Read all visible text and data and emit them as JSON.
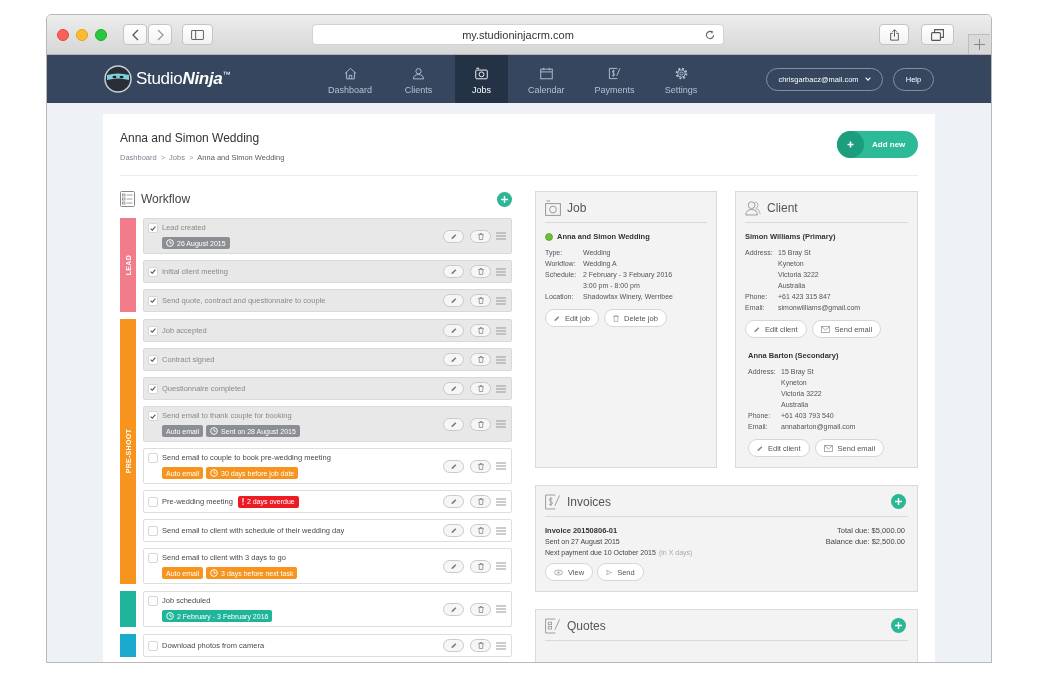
{
  "browser": {
    "url": "my.studioninjacrm.com"
  },
  "nav": {
    "logo": "Studio**Ninja**$^{™}$",
    "items": [
      {
        "label": "Dashboard",
        "selected": false
      },
      {
        "label": "Clients",
        "selected": false
      },
      {
        "label": "Jobs",
        "selected": true
      },
      {
        "label": "Calendar",
        "selected": false
      },
      {
        "label": "Payments",
        "selected": false
      },
      {
        "label": "Settings",
        "selected": false
      }
    ],
    "account": "chrisgarbacz@mail.com",
    "help": "Help"
  },
  "page": {
    "title": "Anna and Simon Wedding",
    "breadcrumb": [
      {
        "kind": "link",
        "text": "Dashboard"
      },
      {
        "kind": "separator",
        "text": ">"
      },
      {
        "kind": "link",
        "text": "Jobs"
      },
      {
        "kind": "separator",
        "text": ">"
      },
      {
        "kind": "current",
        "text": "Anna and Simon Wedding"
      }
    ],
    "add_button": "Add new"
  },
  "workflow": {
    "title": "Workflow",
    "stages": [
      {
        "label": "LEAD",
        "color": "#f07c8c",
        "tasks": [
          {
            "label": "Lead created",
            "checked": true,
            "tags": [
              {
                "kind": "clock",
                "text": "26 August 2015",
                "color": "#8b8e93"
              }
            ]
          },
          {
            "label": "Initial client meeting",
            "checked": true
          },
          {
            "label": "Send quote, contract and questionnaire to couple",
            "checked": true
          }
        ]
      },
      {
        "label": "PRE-SHOOT",
        "color": "#f7941e",
        "tasks": [
          {
            "label": "Job accepted",
            "checked": true
          },
          {
            "label": "Contract signed",
            "checked": true
          },
          {
            "label": "Questionnaire completed",
            "checked": true
          },
          {
            "label": "Send email to thank couple for booking",
            "checked": true,
            "tags": [
              {
                "kind": "plain",
                "text": "Auto email",
                "color": "#8b8e93"
              },
              {
                "kind": "clock",
                "text": "Sent on 28 August 2015",
                "color": "#8b8e93"
              }
            ]
          },
          {
            "label": "Send email to couple to book pre-wedding meeting",
            "checked": false,
            "tags": [
              {
                "kind": "plain",
                "text": "Auto email",
                "color": "#f7941e"
              },
              {
                "kind": "clock",
                "text": "30 days before job date",
                "color": "#f7941e"
              }
            ]
          },
          {
            "label": "Pre-wedding meeting",
            "checked": false,
            "tags": [
              {
                "kind": "alert",
                "text": "2 days overdue",
                "color": "#ed1c24"
              }
            ]
          },
          {
            "label": "Send email to client with schedule of their wedding day",
            "checked": false
          },
          {
            "label": "Send email to client with 3 days to go",
            "checked": false,
            "tags": [
              {
                "kind": "plain",
                "text": "Auto email",
                "color": "#f7941e"
              },
              {
                "kind": "clock",
                "text": "3 days before next task",
                "color": "#f7941e"
              }
            ]
          }
        ]
      },
      {
        "color": "#20b59a",
        "tasks": [
          {
            "label": "Job scheduled",
            "checked": false,
            "tags": [
              {
                "kind": "clock",
                "text": "2 February - 3 February 2016",
                "color": "#20b59a"
              }
            ]
          }
        ]
      },
      {
        "color": "#1ca9cf",
        "tasks": [
          {
            "label": "Download photos from camera",
            "checked": false
          }
        ]
      }
    ]
  },
  "job": {
    "title": "Job",
    "name": "Anna and Simon Wedding",
    "details": [
      {
        "label": "Type:",
        "lines": [
          "Wedding"
        ]
      },
      {
        "label": "Workflow:",
        "lines": [
          "Wedding A"
        ]
      },
      {
        "label": "Schedule:",
        "lines": [
          "2 February - 3 Febuary 2016",
          "3:00 pm - 8:00 pm"
        ]
      },
      {
        "label": "Location:",
        "lines": [
          "Shadowfax Winery, Werribee"
        ]
      }
    ],
    "buttons": [
      {
        "kind": "edit",
        "label": "Edit job"
      },
      {
        "kind": "delete",
        "label": "Delete job"
      }
    ]
  },
  "client": {
    "title": "Client",
    "contacts": [
      {
        "name": "Simon Williams (Primary)",
        "details": [
          {
            "label": "Address:",
            "lines": [
              "15 Bray St",
              "Kyneton",
              "Victoria 3222",
              "Australia"
            ]
          },
          {
            "label": "Phone:",
            "lines": [
              "+61 423 315 847"
            ]
          },
          {
            "label": "Email:",
            "lines": [
              "simonwilliams@gmail.com"
            ]
          }
        ],
        "buttons": [
          {
            "kind": "edit",
            "label": "Edit client"
          },
          {
            "kind": "email",
            "label": "Send email"
          }
        ]
      },
      {
        "name": "Anna Barton (Secondary)",
        "details": [
          {
            "label": "Address:",
            "lines": [
              "15 Bray St",
              "Kyneton",
              "Victoria 3222",
              "Australia"
            ]
          },
          {
            "label": "Phone:",
            "lines": [
              "+61 403 793 540"
            ]
          },
          {
            "label": "Email:",
            "lines": [
              "annabarton@gmail.com"
            ]
          }
        ],
        "buttons": [
          {
            "kind": "edit",
            "label": "Edit client"
          },
          {
            "kind": "email",
            "label": "Send email"
          }
        ]
      }
    ]
  },
  "invoices": {
    "title": "Invoices",
    "items": [
      {
        "number": "Invoice 20150806-01",
        "sent": "Sent on 27 August 2015",
        "next_payment": "Next payment due 10 October 2015",
        "next_payment_note": "(in X days)",
        "total": "Total due: $5,000.00",
        "balance": "Balance due: $2,500.00",
        "buttons": [
          {
            "kind": "view",
            "label": "View"
          },
          {
            "kind": "send",
            "label": "Send"
          }
        ]
      }
    ]
  },
  "quotes": {
    "title": "Quotes"
  }
}
